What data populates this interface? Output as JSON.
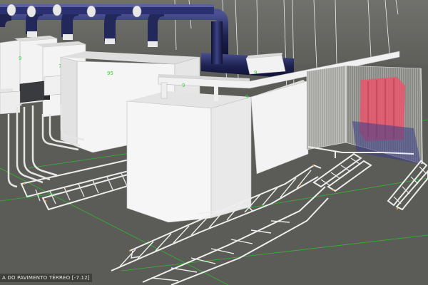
{
  "viewport": {
    "level_label": "A DO PAVIMENTO TÉRREO [-7.12]"
  },
  "panels": {
    "panel_1_label": "9",
    "panel_2_label": "7",
    "panel_3_label": "95",
    "panel_4_label": "9",
    "panel_5_label": "9",
    "duct_box_label": "9"
  },
  "colors": {
    "background": "#5b5c57",
    "panel_face": "#f4f4f4",
    "panel_side": "#d8d8d8",
    "duct": "#1e2350",
    "cable_tray": "#e2e2e2",
    "transformer": "#e8566b",
    "guide_line": "#2fb82f",
    "label_green": "#35d435"
  }
}
